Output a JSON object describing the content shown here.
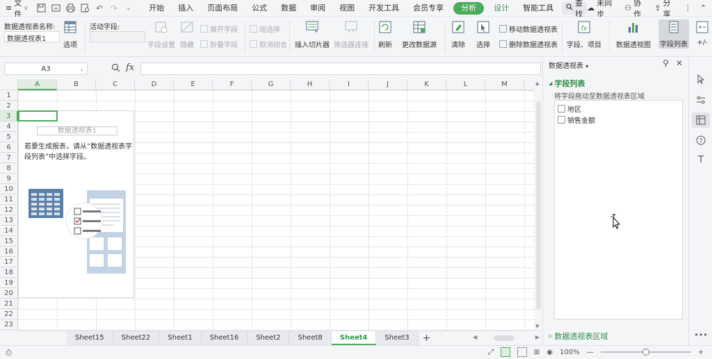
{
  "menubar": {
    "file_label": "文件",
    "tabs": [
      {
        "label": "开始"
      },
      {
        "label": "插入"
      },
      {
        "label": "页面布局"
      },
      {
        "label": "公式"
      },
      {
        "label": "数据"
      },
      {
        "label": "审阅"
      },
      {
        "label": "视图"
      },
      {
        "label": "开发工具"
      },
      {
        "label": "会员专享"
      },
      {
        "label": "分析"
      },
      {
        "label": "设计"
      },
      {
        "label": "智能工具"
      }
    ],
    "search_label": "查找",
    "unsynced_label": "未同步",
    "collab_label": "协作",
    "share_label": "分享"
  },
  "ribbon": {
    "pivot_name_label": "数据透视表名称:",
    "pivot_name_value": "数据透视表1",
    "options_label": "选项",
    "active_field_label": "活动字段:",
    "field_settings_label": "字段设置",
    "hide_label": "隐藏",
    "expand_field_label": "展开字段",
    "collapse_field_label": "折叠字段",
    "group_select_label": "组选择",
    "ungroup_label": "取消组合",
    "insert_slicer_label": "插入切片器",
    "filter_conn_label": "筛选器连接",
    "refresh_label": "刷新",
    "change_source_label": "更改数据源",
    "clear_label": "清除",
    "select_label": "选择",
    "move_pivot_label": "移动数据透视表",
    "delete_pivot_label": "删除数据透视表",
    "field_item_label": "字段、项目",
    "pivot_chart_label": "数据透视图",
    "field_list_label": "字段列表",
    "plus_minus_label": "+/-"
  },
  "formula": {
    "name_box": "A3",
    "fx_label": "fx",
    "content": ""
  },
  "sheet": {
    "columns": [
      "A",
      "B",
      "C",
      "D",
      "E",
      "F",
      "G",
      "H",
      "I",
      "J",
      "K",
      "L",
      "M"
    ],
    "rows": [
      "1",
      "2",
      "3",
      "4",
      "5",
      "6",
      "7",
      "8",
      "9",
      "10",
      "11",
      "12",
      "13",
      "14",
      "15",
      "16",
      "17",
      "18",
      "19",
      "20",
      "21",
      "22",
      "23"
    ],
    "pivot_placeholder_title": "数据透视表1",
    "pivot_placeholder_msg": "若要生成报表，请从“数据透视表字段列表”中选择字段。"
  },
  "sheet_tabs": [
    "Sheet15",
    "Sheet22",
    "Sheet1",
    "Sheet16",
    "Sheet2",
    "Sheet8",
    "Sheet4",
    "Sheet3"
  ],
  "active_sheet": "Sheet4",
  "status": {
    "zoom": "100%"
  },
  "pane": {
    "title": "数据透视表",
    "field_list_heading": "字段列表",
    "hint": "将字段拖动至数据透视表区域",
    "fields": [
      {
        "label": "地区",
        "checked": false
      },
      {
        "label": "销售金额",
        "checked": false
      }
    ],
    "areas_heading": "数据透视表区域"
  },
  "colors": {
    "accent": "#4aab5d",
    "accent_text": "#2f8c45"
  }
}
